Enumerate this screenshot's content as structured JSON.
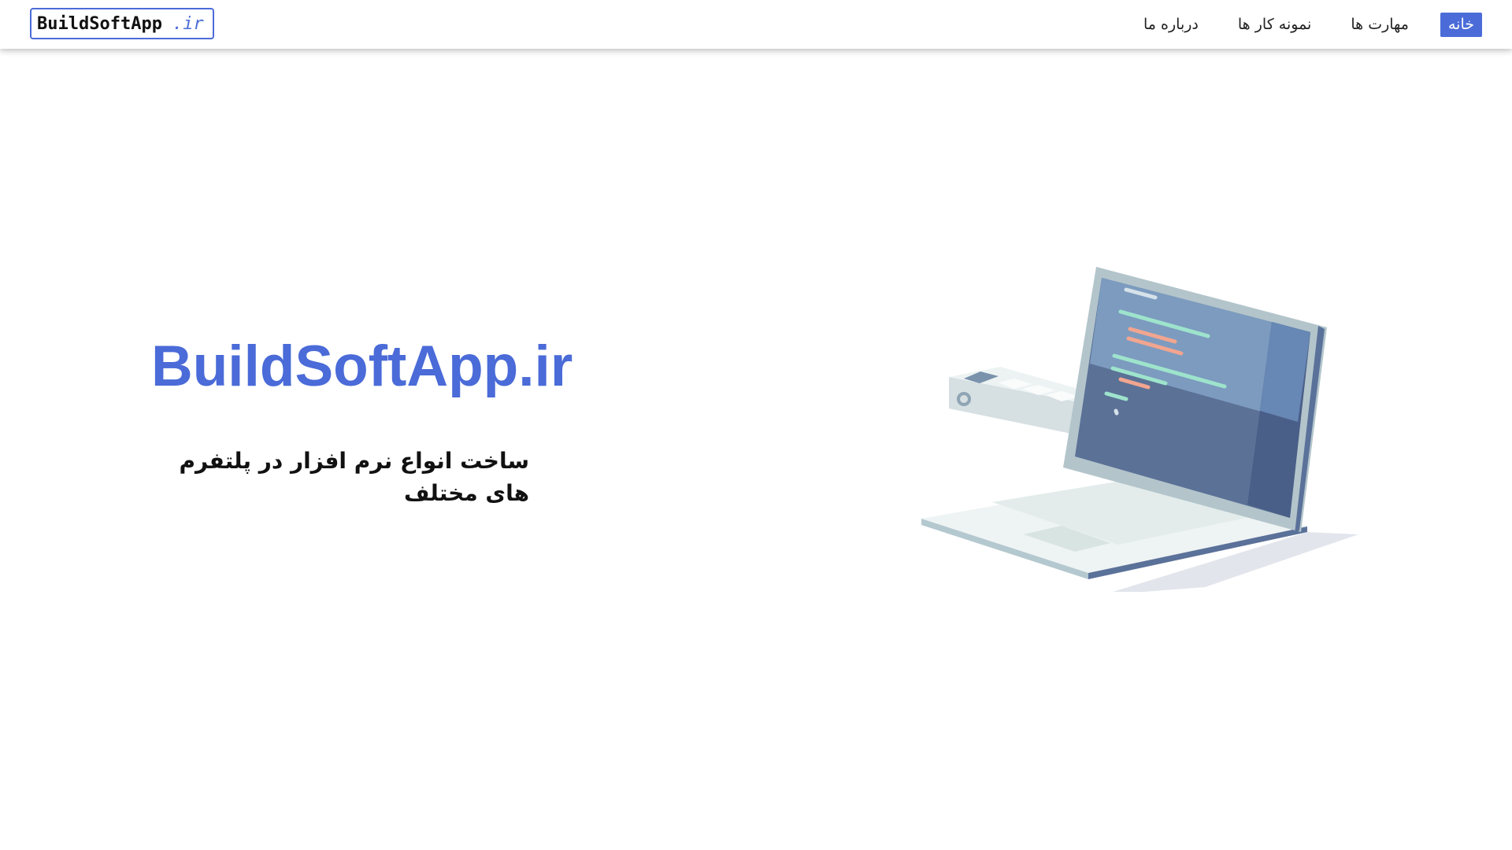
{
  "header": {
    "logo": {
      "main": "BuildSoftApp",
      "tld": ".ir"
    },
    "nav": [
      {
        "id": "home",
        "label": "خانه",
        "active": true
      },
      {
        "id": "skills",
        "label": "مهارت ها",
        "active": false
      },
      {
        "id": "portfolio",
        "label": "نمونه کار ها",
        "active": false
      },
      {
        "id": "about",
        "label": "درباره ما",
        "active": false
      }
    ]
  },
  "hero": {
    "title": "BuildSoftApp.ir",
    "subtitle": "ساخت انواع نرم افزار در پلتفرم های مختلف",
    "illustration": "laptop-code-illustration"
  },
  "colors": {
    "accent": "#4b6cd8",
    "header_bg": "#ffffff",
    "page_bg": "#ffffff",
    "text": "#111111"
  }
}
